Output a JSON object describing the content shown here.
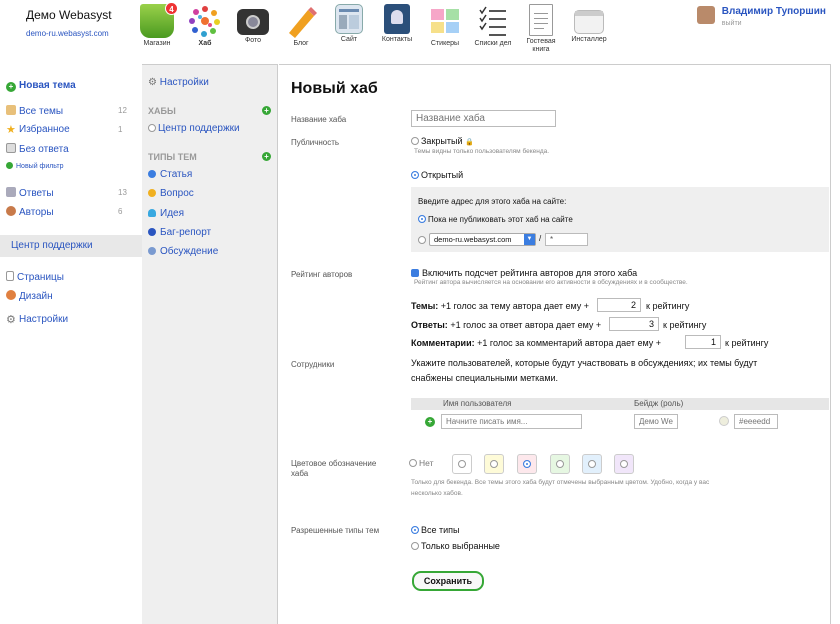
{
  "brand": {
    "title": "Демо Webasyst",
    "url": "demo-ru.webasyst.com"
  },
  "apps": [
    {
      "label": "Магазин",
      "icon": "shop-basket-icon",
      "badge": "4"
    },
    {
      "label": "Хаб",
      "icon": "hub-icon"
    },
    {
      "label": "Фото",
      "icon": "camera-icon"
    },
    {
      "label": "Блог",
      "icon": "pencil-icon"
    },
    {
      "label": "Сайт",
      "icon": "site-icon"
    },
    {
      "label": "Контакты",
      "icon": "contacts-icon"
    },
    {
      "label": "Стикеры",
      "icon": "stickies-icon"
    },
    {
      "label": "Списки дел",
      "icon": "checklist-icon"
    },
    {
      "label": "Гостевая книга",
      "icon": "guestbook-icon"
    },
    {
      "label": "Инсталлер",
      "icon": "installer-icon"
    }
  ],
  "user": {
    "name": "Владимир Тупоршин",
    "logout": "выйти"
  },
  "left": {
    "new_topic": "Новая тема",
    "all_topics": "Все темы",
    "all_count": "12",
    "favorites": "Избранное",
    "fav_count": "1",
    "no_answer": "Без ответа",
    "new_filter": "Новый фильтр",
    "answers": "Ответы",
    "answers_count": "13",
    "authors": "Авторы",
    "authors_count": "6",
    "support_center": "Центр поддержки",
    "pages": "Страницы",
    "design": "Дизайн",
    "settings": "Настройки"
  },
  "mid": {
    "settings": "Настройки",
    "hubs_header": "ХАБЫ",
    "support": "Центр поддержки",
    "types_header": "ТИПЫ ТЕМ",
    "types": [
      "Статья",
      "Вопрос",
      "Идея",
      "Баг-репорт",
      "Обсуждение"
    ],
    "type_colors": [
      "#3b7de0",
      "#f0b020",
      "#38a8e0",
      "#2a55c0",
      "#7a9ad0"
    ]
  },
  "form": {
    "title": "Новый хаб",
    "name_label": "Название хаба",
    "name_placeholder": "Название хаба",
    "public_label": "Публичность",
    "closed": "Закрытый",
    "closed_hint": "Темы видны только пользователям бекенда.",
    "open": "Открытый",
    "url_prompt": "Введите адрес для этого хаба на сайте:",
    "no_publish": "Пока не публиковать этот хаб на сайте",
    "domain": "demo-ru.webasyst.com",
    "slash": "/",
    "url_value": "*",
    "rating_label": "Рейтинг авторов",
    "rating_enable": "Включить подсчет рейтинга авторов для этого хаба",
    "rating_hint": "Рейтинг автора вычисляется на основании его активности в обсуждениях и в сообществе.",
    "topics_b": "Темы:",
    "topics_t": "+1 голос за тему автора дает ему +",
    "topics_v": "2",
    "topics_s": "к рейтингу",
    "answers_b": "Ответы:",
    "answers_t": "+1 голос за ответ автора дает ему +",
    "answers_v": "3",
    "answers_s": "к рейтингу",
    "comments_b": "Комментарии:",
    "comments_t": "+1 голос за комментарий автора дает ему +",
    "comments_v": "1",
    "comments_s": "к рейтингу",
    "staff_label": "Сотрудники",
    "staff_desc1": "Укажите пользователей, которые будут участвовать в обсуждениях; их темы будут",
    "staff_desc2": "снабжены специальными метками.",
    "col_user": "Имя пользователя",
    "col_badge": "Бейдж (роль)",
    "user_placeholder": "Начните писать имя...",
    "badge_placeholder": "Демо We",
    "color_placeholder": "#eeeedd",
    "color_label1": "Цветовое обозначение",
    "color_label2": "хаба",
    "color_none": "Нет",
    "color_hint1": "Только для бекенда. Все темы этого хаба будут отмечены выбранным цветом. Удобно, когда у вас",
    "color_hint2": "несколько хабов.",
    "color_swatches": [
      "#ffffff",
      "#fefbd8",
      "#fde8ec",
      "#e6f7e2",
      "#e2f0fc",
      "#f1e6fa"
    ],
    "types_label": "Разрешенные типы тем",
    "all_types": "Все типы",
    "selected_types": "Только выбранные",
    "save": "Сохранить"
  }
}
